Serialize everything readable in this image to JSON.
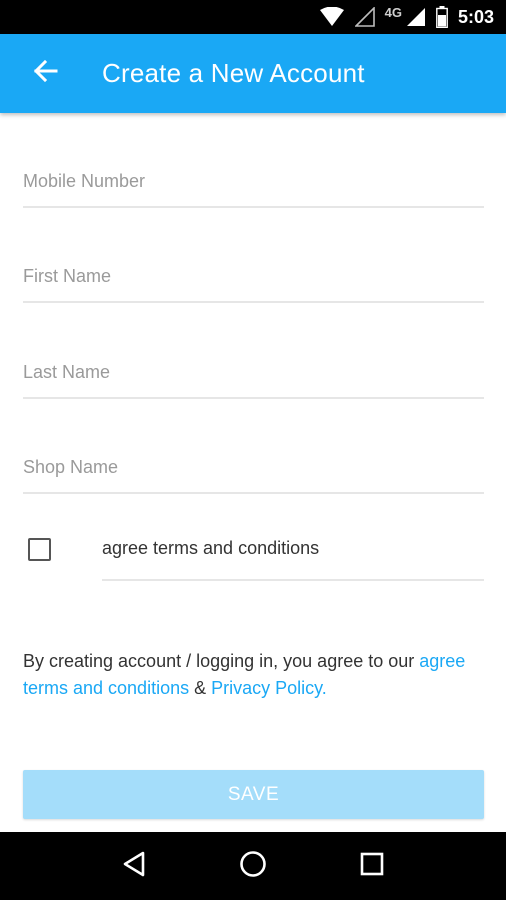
{
  "status_bar": {
    "network_label": "4G",
    "time": "5:03",
    "icons": [
      "wifi-icon",
      "signal-empty-icon",
      "signal-icon",
      "battery-icon"
    ]
  },
  "app_bar": {
    "title": "Create a New Account",
    "back_icon": "arrow-left-icon",
    "background_color": "#1aa8f5"
  },
  "form": {
    "fields": [
      {
        "placeholder": "Mobile Number",
        "value": ""
      },
      {
        "placeholder": "First Name",
        "value": ""
      },
      {
        "placeholder": "Last Name",
        "value": ""
      },
      {
        "placeholder": "Shop Name",
        "value": ""
      }
    ],
    "agree_checkbox": {
      "label": "agree terms and conditions",
      "checked": false
    }
  },
  "terms": {
    "prefix": "By creating account / logging in, you agree to our ",
    "terms_link": "agree terms and conditions",
    "separator": " & ",
    "privacy_link": "Privacy Policy."
  },
  "save_button": {
    "label": "SAVE",
    "enabled": false,
    "color": "#a4ddfa"
  },
  "nav_bar": {
    "icons": [
      "back-triangle-icon",
      "home-circle-icon",
      "recents-square-icon"
    ]
  }
}
